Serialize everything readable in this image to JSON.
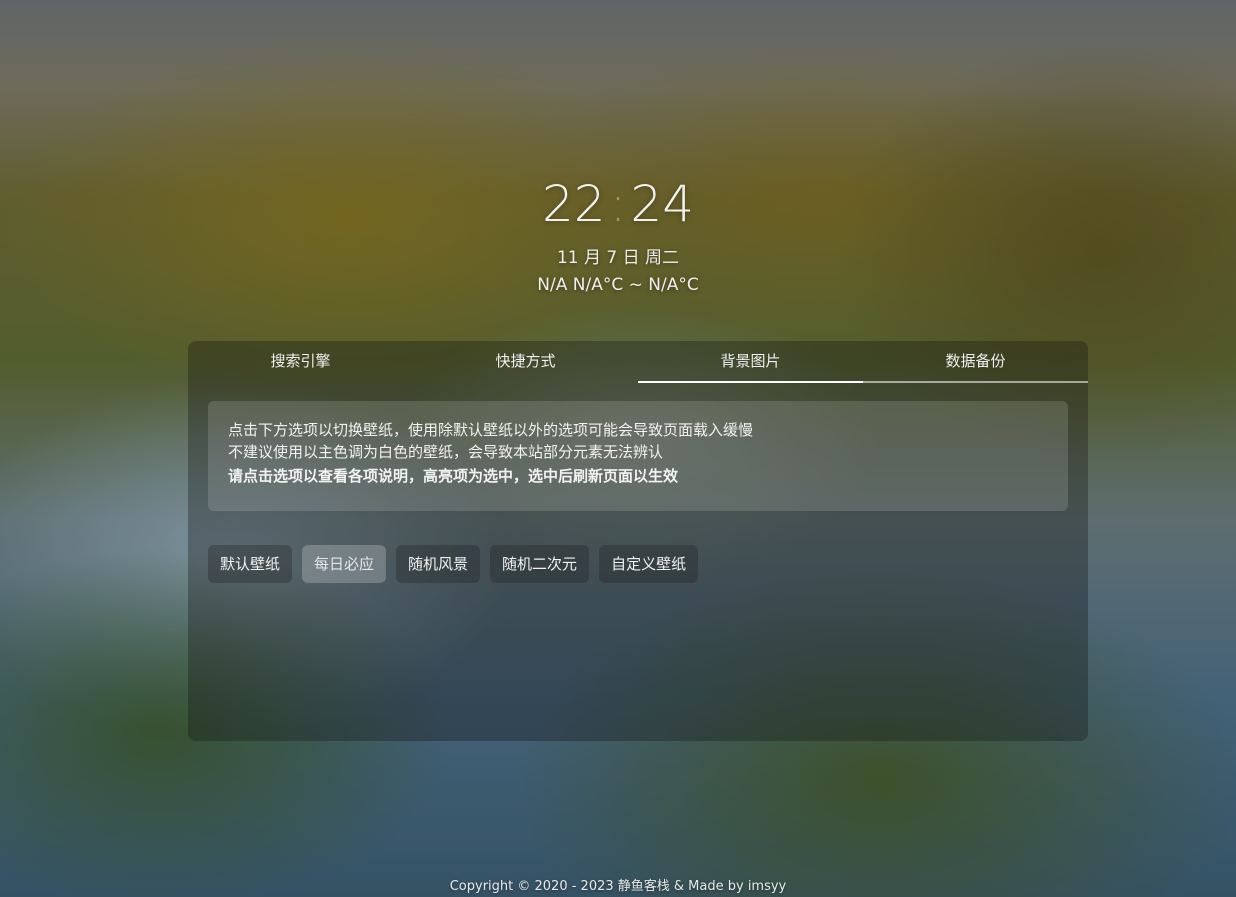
{
  "clock": {
    "hours": "22",
    "separator": ":",
    "minutes": "24"
  },
  "date": {
    "text": "11 月 7 日 周二"
  },
  "weather": {
    "text": "N/A N/A°C ~ N/A°C"
  },
  "tabs": [
    {
      "label": "搜索引擎"
    },
    {
      "label": "快捷方式"
    },
    {
      "label": "背景图片"
    },
    {
      "label": "数据备份"
    }
  ],
  "notice": {
    "line1": "点击下方选项以切换壁纸，使用除默认壁纸以外的选项可能会导致页面载入缓慢",
    "line2": "不建议使用以主色调为白色的壁纸，会导致本站部分元素无法辨认",
    "line3": "请点击选项以查看各项说明，高亮项为选中，选中后刷新页面以生效"
  },
  "options": [
    {
      "label": "默认壁纸"
    },
    {
      "label": "每日必应"
    },
    {
      "label": "随机风景"
    },
    {
      "label": "随机二次元"
    },
    {
      "label": "自定义壁纸"
    }
  ],
  "footer": {
    "text": "Copyright © 2020 - 2023 静鱼客栈 &  Made by imsyy"
  }
}
